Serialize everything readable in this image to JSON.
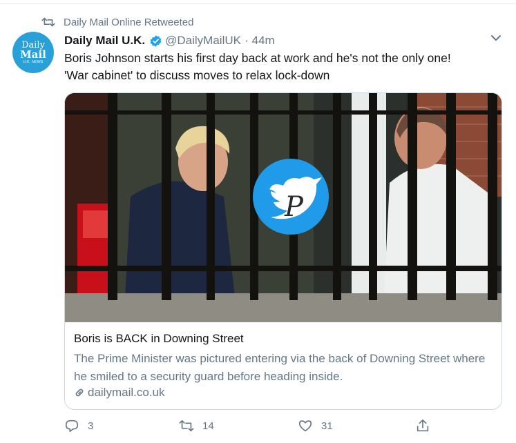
{
  "retweet": {
    "icon": "retweet-icon",
    "label": "Daily Mail Online Retweeted"
  },
  "author": {
    "avatar_lines": [
      "Daily",
      "Mail",
      "U.K. NEWS"
    ],
    "name": "Daily Mail U.K.",
    "verified_icon": "verified-badge-icon",
    "handle": "@DailyMailUK",
    "separator": "·",
    "time": "44m"
  },
  "menu": {
    "icon": "chevron-down-icon"
  },
  "tweet": {
    "text_line1": "Boris Johnson starts his first day back at work and he's not the only one!",
    "text_line2": "'War cabinet' to discuss moves to relax lock-down"
  },
  "card": {
    "image_alt": "photo-through-railings",
    "watermark_letter": "P",
    "title": "Boris is BACK in Downing Street",
    "description": "The Prime Minister was pictured entering via the back of Downing Street where he smiled to a security guard before heading inside.",
    "link_icon": "link-icon",
    "link": "dailymail.co.uk"
  },
  "actions": {
    "reply": {
      "icon": "reply-icon",
      "count": "3"
    },
    "retweet": {
      "icon": "retweet-icon",
      "count": "14"
    },
    "like": {
      "icon": "heart-icon",
      "count": "31"
    },
    "share": {
      "icon": "share-icon"
    }
  },
  "colors": {
    "accent": "#1da1f2",
    "muted": "#657786",
    "text": "#14171a",
    "verified": "#1da1f2",
    "avatar": "#29a0d8"
  }
}
